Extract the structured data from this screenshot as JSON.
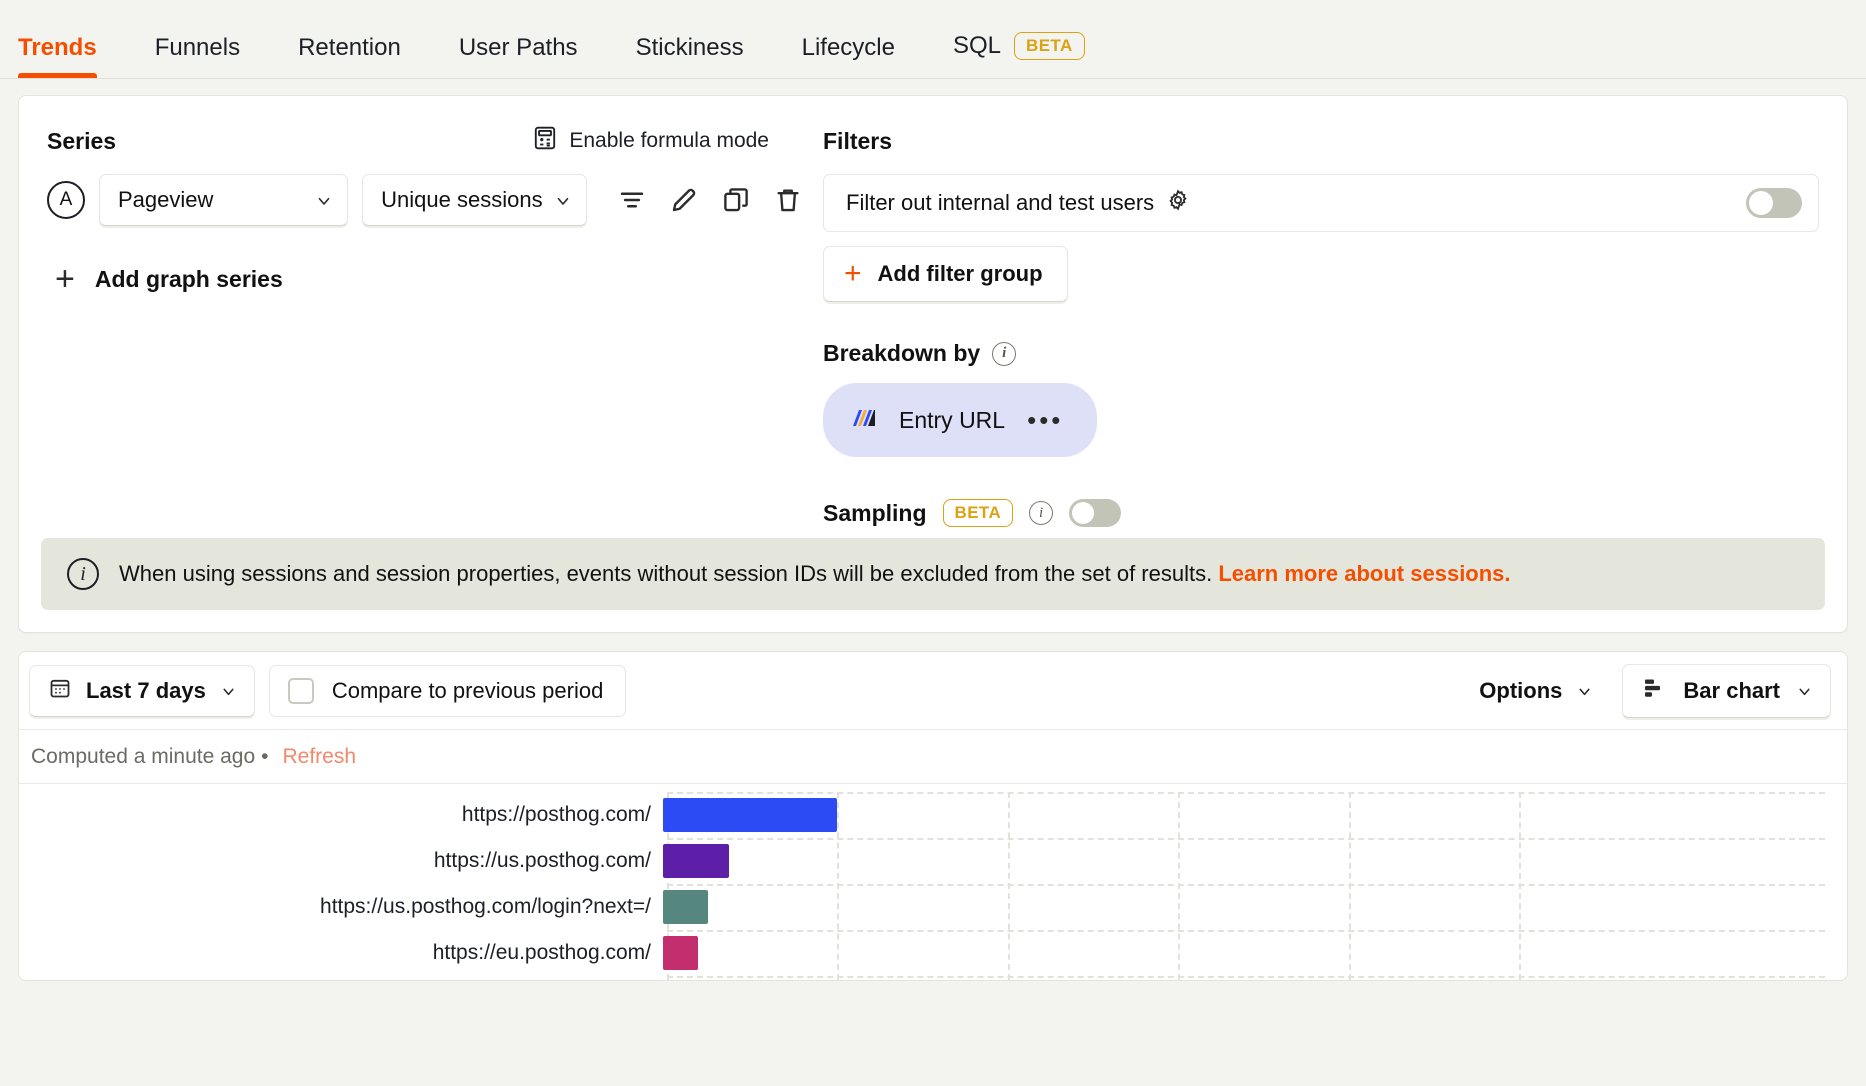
{
  "tabs": [
    {
      "label": "Trends",
      "active": true
    },
    {
      "label": "Funnels",
      "active": false
    },
    {
      "label": "Retention",
      "active": false
    },
    {
      "label": "User Paths",
      "active": false
    },
    {
      "label": "Stickiness",
      "active": false
    },
    {
      "label": "Lifecycle",
      "active": false
    }
  ],
  "sql_tab": {
    "label": "SQL",
    "badge": "BETA"
  },
  "series": {
    "title": "Series",
    "formula_mode_label": "Enable formula mode",
    "letter": "A",
    "event": "Pageview",
    "math": "Unique sessions",
    "add_series_label": "Add graph series",
    "add_series_plus": "+",
    "row_icons": [
      "filter-icon",
      "pencil-icon",
      "duplicate-icon",
      "trash-icon"
    ]
  },
  "filters": {
    "title": "Filters",
    "internal_filter_label": "Filter out internal and test users",
    "internal_filter_enabled": false,
    "add_filter_group_label": "Add filter group",
    "add_filter_group_plus": "+"
  },
  "breakdown": {
    "title": "Breakdown by",
    "info": "i",
    "pill_label": "Entry URL",
    "pill_more": "•••"
  },
  "sampling": {
    "label": "Sampling",
    "badge": "BETA",
    "info": "i",
    "enabled": false
  },
  "banner": {
    "icon": "i",
    "text": "When using sessions and session properties, events without session IDs will be excluded from the set of results.",
    "link": "Learn more about sessions."
  },
  "chart_toolbar": {
    "date_range": "Last 7 days",
    "compare_label": "Compare to previous period",
    "compare_checked": false,
    "options_label": "Options",
    "chart_type_label": "Bar chart"
  },
  "computed": {
    "text": "Computed a minute ago",
    "separator": "•",
    "refresh": "Refresh"
  },
  "colors": {
    "accent": "#F54E00",
    "beta": "#DBA313",
    "refresh": "#F1896B",
    "breakdown_pill_bg": "#DEE0F7",
    "banner_bg": "#E4E6DC"
  },
  "chart_data": {
    "type": "bar",
    "orientation": "horizontal",
    "title": "",
    "xlabel": "",
    "ylabel": "",
    "grid": true,
    "legend": "none",
    "categories": [
      "https://posthog.com/",
      "https://us.posthog.com/",
      "https://us.posthog.com/login?next=/",
      "https://eu.posthog.com/"
    ],
    "values": [
      100,
      38,
      26,
      20
    ],
    "xlim": [
      0,
      490
    ],
    "bar_colors": [
      "#2C4BF5",
      "#5D1FA8",
      "#55877F",
      "#C32E6E"
    ],
    "gridline_x_positions": [
      0,
      98,
      196,
      294,
      392,
      490
    ]
  }
}
